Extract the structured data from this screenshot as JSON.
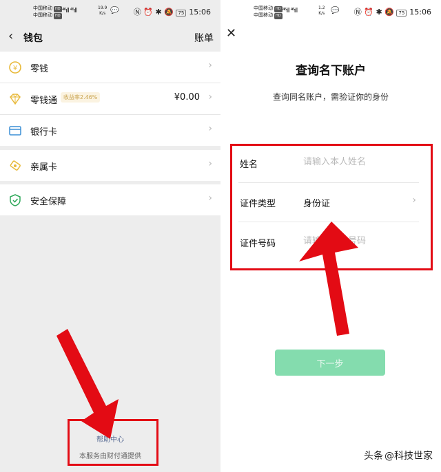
{
  "left": {
    "status": {
      "carrier1": "中国移动",
      "carrier2": "中国移动",
      "hd": "HD",
      "speed_value": "19.9",
      "speed_unit": "K/s",
      "battery": "75",
      "time": "15:06"
    },
    "header": {
      "title": "钱包",
      "bill_label": "账单"
    },
    "items": [
      {
        "label": "零钱",
        "icon": "coin-icon",
        "value": ""
      },
      {
        "label": "零钱通",
        "icon": "diamond-icon",
        "badge": "收益率2.46%",
        "value": "¥0.00"
      },
      {
        "label": "银行卡",
        "icon": "bank-card-icon",
        "value": ""
      },
      {
        "label": "亲属卡",
        "icon": "family-card-icon",
        "value": ""
      },
      {
        "label": "安全保障",
        "icon": "shield-icon",
        "value": ""
      }
    ],
    "footer": {
      "help_label": "帮助中心",
      "provider_text": "本服务由财付通提供"
    }
  },
  "right": {
    "status": {
      "carrier1": "中国移动",
      "carrier2": "中国移动",
      "hd": "HD",
      "speed_value": "1.2",
      "speed_unit": "K/s",
      "battery": "75",
      "time": "15:06"
    },
    "title": "查询名下账户",
    "subtitle": "查询同名账户，需验证你的身份",
    "form": {
      "name_label": "姓名",
      "name_placeholder": "请输入本人姓名",
      "id_type_label": "证件类型",
      "id_type_value": "身份证",
      "id_number_label": "证件号码",
      "id_number_placeholder": "请输入证件号码"
    },
    "next_label": "下一步"
  },
  "watermark": {
    "prefix": "头条",
    "author": "@科技世家"
  },
  "colors": {
    "accent_red": "#e30b14",
    "wechat_green": "#84dcae",
    "link_blue": "#586b94",
    "badge_gold": "#c9a34e"
  }
}
